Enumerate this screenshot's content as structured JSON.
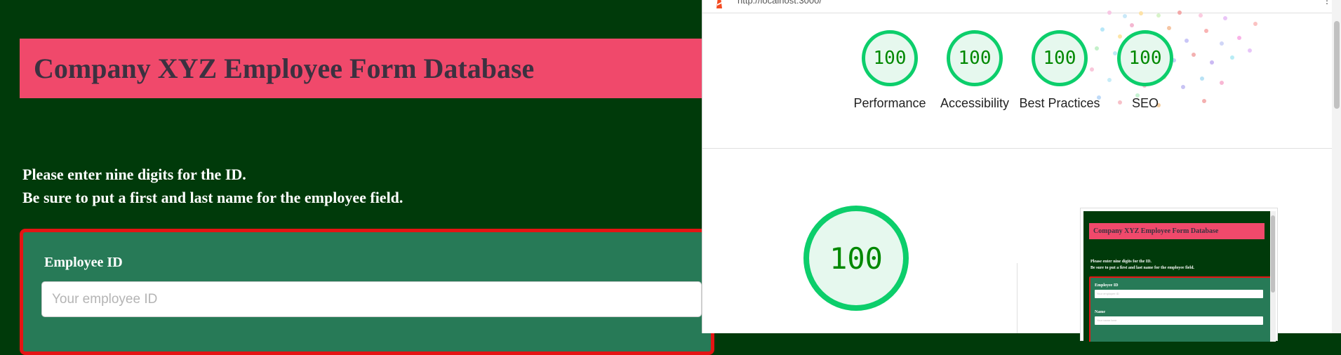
{
  "app": {
    "title": "Company XYZ Employee Form Database",
    "instructions": [
      "Please enter nine digits for the ID.",
      "Be sure to put a first and last name for the employee field."
    ],
    "form": {
      "employee_id_label": "Employee ID",
      "employee_id_placeholder": "Your employee ID",
      "name_label": "Name",
      "name_placeholder": "Your name here"
    },
    "colors": {
      "page_bg": "#003a0a",
      "banner_bg": "#f0496b",
      "card_bg": "#277a57",
      "card_border": "#e41414"
    }
  },
  "lighthouse": {
    "url": "http://localhost:3000/",
    "logo_icon": "lighthouse-icon",
    "menu_icon": "kebab-menu-icon",
    "scores": [
      {
        "label": "Performance",
        "value": "100"
      },
      {
        "label": "Accessibility",
        "value": "100"
      },
      {
        "label": "Best Practices",
        "value": "100"
      },
      {
        "label": "SEO",
        "value": "100"
      }
    ],
    "main_score": "100",
    "colors": {
      "pass_green": "#0cce6b",
      "pass_text": "#008800",
      "gauge_fill": "#e6f8ee"
    }
  }
}
